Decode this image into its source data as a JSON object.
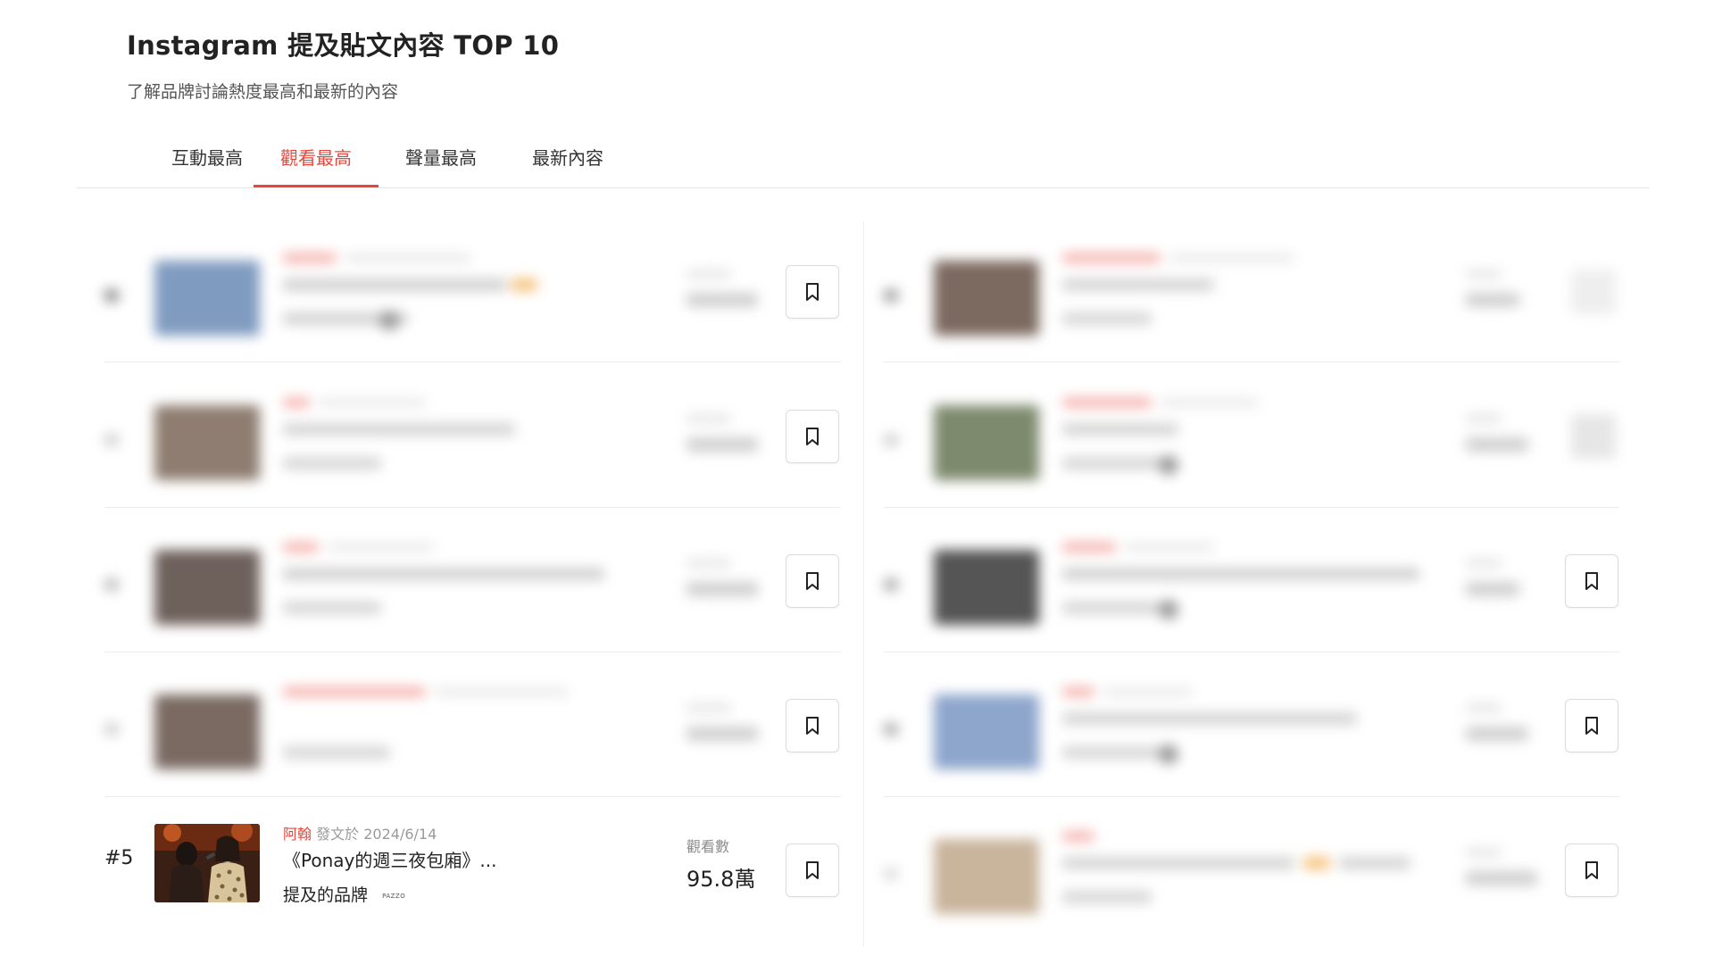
{
  "header": {
    "title": "Instagram 提及貼文內容 TOP 10",
    "subtitle": "了解品牌討論熱度最高和最新的內容"
  },
  "tabs": [
    {
      "label": "互動最高",
      "active": false
    },
    {
      "label": "觀看最高",
      "active": true
    },
    {
      "label": "聲量最高",
      "active": false
    },
    {
      "label": "最新內容",
      "active": false
    }
  ],
  "accent_color": "#e8463a",
  "posts": [
    {
      "rank": "#5",
      "author": "阿翰",
      "posted_prefix": "發文於",
      "date": "2024/6/14",
      "title": "《Ponay的週三夜包廂》...",
      "brands_label": "提及的品牌",
      "brand": "PAZZO",
      "stat_label": "觀看數",
      "stat_value": "95.8萬",
      "bookmark_icon": "bookmark-icon"
    }
  ]
}
